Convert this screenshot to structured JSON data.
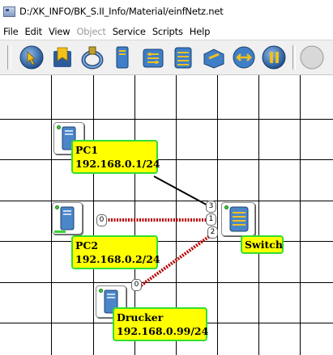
{
  "window": {
    "title": "D:/XK_INFO/BK_S.II_Info/Material/einfNetz.net"
  },
  "menu": {
    "items": [
      {
        "label": "File",
        "enabled": true
      },
      {
        "label": "Edit",
        "enabled": true
      },
      {
        "label": "View",
        "enabled": true
      },
      {
        "label": "Object",
        "enabled": false
      },
      {
        "label": "Service",
        "enabled": true
      },
      {
        "label": "Scripts",
        "enabled": true
      },
      {
        "label": "Help",
        "enabled": true
      }
    ]
  },
  "toolbar": {
    "buttons": [
      {
        "name": "select-tool-icon"
      },
      {
        "name": "document-tool-icon"
      },
      {
        "name": "cable-tool-icon"
      },
      {
        "name": "computer-tool-icon"
      },
      {
        "name": "router-tool-icon"
      },
      {
        "name": "switch-tool-icon"
      },
      {
        "name": "modem-tool-icon"
      },
      {
        "name": "hub-tool-icon"
      },
      {
        "name": "pause-tool-icon"
      }
    ]
  },
  "network": {
    "nodes": {
      "pc1": {
        "line1": "PC1",
        "line2": "192.168.0.1/24"
      },
      "pc2": {
        "line1": "PC2",
        "line2": "192.168.0.2/24"
      },
      "printer": {
        "line1": "Drucker",
        "line2": "192.168.0.99/24"
      },
      "switch": {
        "label": "Switch"
      }
    },
    "ports": {
      "pc2_port": "0",
      "printer_port": "0",
      "switch_port_3": "3",
      "switch_port_1": "1",
      "switch_port_2": "2"
    }
  },
  "colors": {
    "label_bg": "#ffff00",
    "label_border": "#33dd33",
    "active_link": "#cc0000",
    "idle_link": "#000000"
  }
}
